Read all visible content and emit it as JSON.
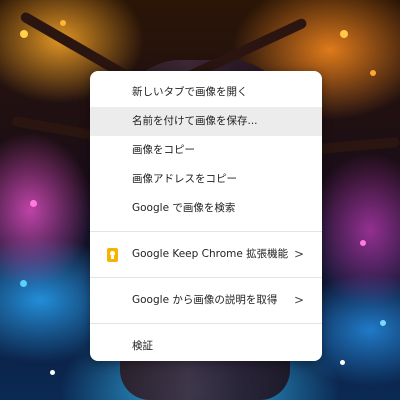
{
  "context_menu": {
    "group1": [
      {
        "label": "新しいタブで画像を開く"
      },
      {
        "label": "名前を付けて画像を保存..."
      },
      {
        "label": "画像をコピー"
      },
      {
        "label": "画像アドレスをコピー"
      },
      {
        "label": "Google で画像を検索"
      }
    ],
    "extensions": {
      "label": "Google Keep Chrome 拡張機能",
      "icon": "google-keep-icon",
      "submenu_icon": "chevron-right-icon",
      "submenu_glyph": ">"
    },
    "lens": {
      "label": "Google から画像の説明を取得",
      "submenu_icon": "chevron-right-icon",
      "submenu_glyph": ">"
    },
    "inspect": {
      "label": "検証"
    }
  },
  "colors": {
    "menu_background": "#ffffff",
    "hover_background": "#ececec",
    "text": "#1f1f1f",
    "keep_icon": "#f6b400"
  }
}
